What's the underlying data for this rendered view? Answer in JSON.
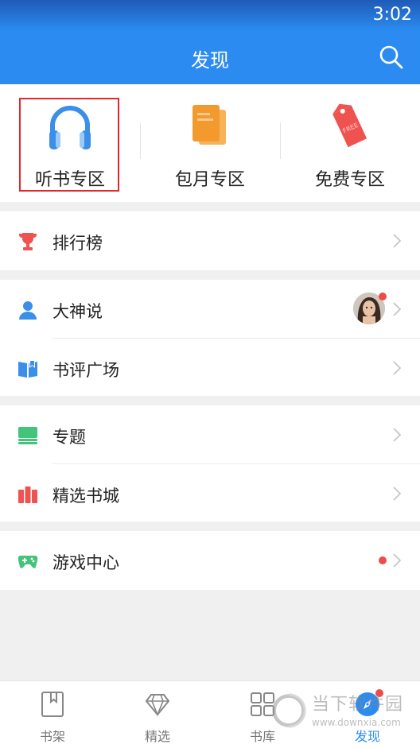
{
  "status_bar": {
    "time": "3:02"
  },
  "header": {
    "title": "发现",
    "search_icon": "search-icon"
  },
  "quick_entries": [
    {
      "label": "听书专区",
      "icon": "headphones-icon",
      "highlighted": true
    },
    {
      "label": "包月专区",
      "icon": "books-icon"
    },
    {
      "label": "免费专区",
      "icon": "free-tag-icon",
      "tag_text": "FREE"
    }
  ],
  "groups": [
    {
      "rows": [
        {
          "label": "排行榜",
          "icon": "trophy-icon"
        }
      ]
    },
    {
      "rows": [
        {
          "label": "大神说",
          "icon": "person-icon",
          "has_avatar": true,
          "has_dot": true
        },
        {
          "label": "书评广场",
          "icon": "book-review-icon"
        }
      ]
    },
    {
      "rows": [
        {
          "label": "专题",
          "icon": "topic-icon"
        },
        {
          "label": "精选书城",
          "icon": "bookshelf-icon"
        }
      ]
    },
    {
      "rows": [
        {
          "label": "游戏中心",
          "icon": "gamepad-icon",
          "has_dot": true
        }
      ]
    }
  ],
  "tabs": [
    {
      "label": "书架",
      "icon": "bookmark-book-icon"
    },
    {
      "label": "精选",
      "icon": "diamond-icon"
    },
    {
      "label": "书库",
      "icon": "grid-icon"
    },
    {
      "label": "发现",
      "icon": "compass-icon",
      "active": true,
      "has_dot": true
    }
  ],
  "watermark": {
    "name": "当下软件园",
    "url": "www.downxia.com"
  },
  "colors": {
    "primary": "#2b8bf0",
    "badge": "#ef4b4b",
    "highlight_box": "#e5262b"
  }
}
